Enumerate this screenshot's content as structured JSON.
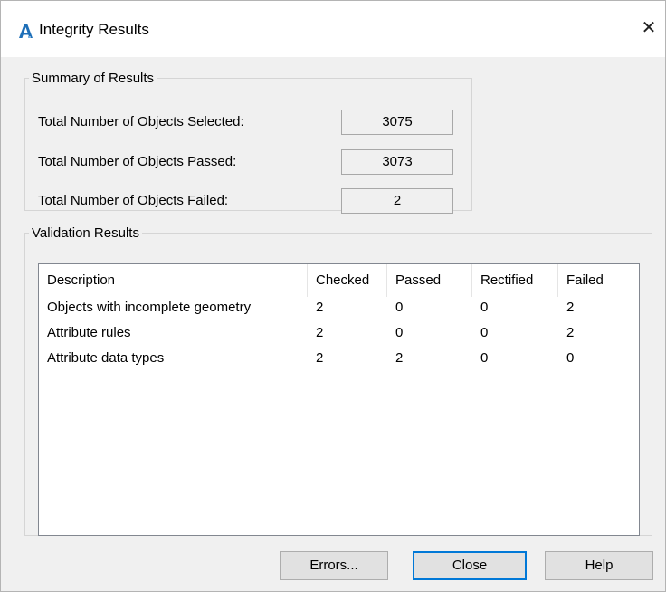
{
  "window": {
    "title": "Integrity Results",
    "icon": "autocad-icon",
    "close_glyph": "✕"
  },
  "summary": {
    "legend": "Summary of Results",
    "rows": [
      {
        "label": "Total Number of Objects Selected:",
        "value": "3075"
      },
      {
        "label": "Total Number of Objects Passed:",
        "value": "3073"
      },
      {
        "label": "Total Number of Objects Failed:",
        "value": "2"
      }
    ]
  },
  "validation": {
    "legend": "Validation Results",
    "columns": [
      "Description",
      "Checked",
      "Passed",
      "Rectified",
      "Failed"
    ],
    "rows": [
      {
        "description": "Objects with incomplete geometry",
        "checked": "2",
        "passed": "0",
        "rectified": "0",
        "failed": "2"
      },
      {
        "description": "Attribute rules",
        "checked": "2",
        "passed": "0",
        "rectified": "0",
        "failed": "2"
      },
      {
        "description": "Attribute data types",
        "checked": "2",
        "passed": "2",
        "rectified": "0",
        "failed": "0"
      }
    ]
  },
  "buttons": {
    "errors": "Errors...",
    "close": "Close",
    "help": "Help"
  }
}
